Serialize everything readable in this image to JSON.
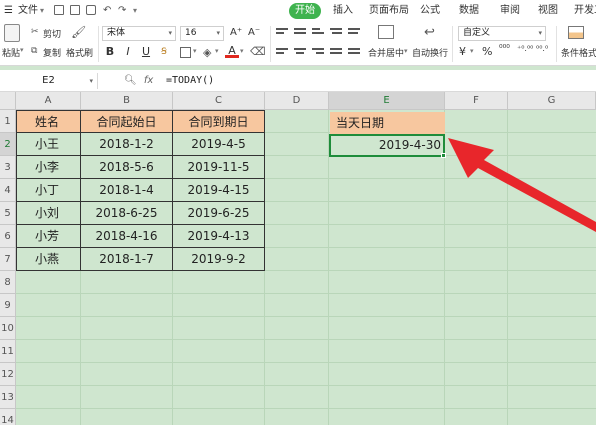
{
  "menubar": {
    "file_label": "文件",
    "tabs": [
      {
        "id": "home",
        "label": "开始"
      },
      {
        "id": "insert",
        "label": "插入"
      },
      {
        "id": "layout",
        "label": "页面布局"
      },
      {
        "id": "formula",
        "label": "公式"
      },
      {
        "id": "data",
        "label": "数据"
      },
      {
        "id": "review",
        "label": "审阅"
      },
      {
        "id": "view",
        "label": "视图"
      },
      {
        "id": "dev",
        "label": "开发工"
      }
    ]
  },
  "ribbon": {
    "paste_label": "粘贴",
    "cut_label": "剪切",
    "copy_label": "复制",
    "format_painter_label": "格式刷",
    "font_name": "宋体",
    "font_size": "16",
    "font_grow": "A⁺",
    "font_shrink": "A⁻",
    "bold": "B",
    "italic": "I",
    "underline": "U",
    "font_color_glyph": "A",
    "merge_center_label": "合并居中",
    "wrap_text_label": "自动换行",
    "number_format": "自定义",
    "currency_glyph": "¥",
    "percent_glyph": "%",
    "thousands_glyph": "⁰⁰⁰",
    "dec_inc": "⁺⁰.⁰⁰",
    "dec_dec": "⁰⁰.⁰",
    "conditional_format_label": "条件格式",
    "accent_color": "#3fb34f"
  },
  "formula_bar": {
    "name_box": "E2",
    "fx_label": "fx",
    "formula": "=TODAY()"
  },
  "sheet": {
    "columns": [
      "A",
      "B",
      "C",
      "D",
      "E",
      "F",
      "G"
    ],
    "rows": [
      "1",
      "2",
      "3",
      "4",
      "5",
      "6",
      "7",
      "8",
      "9",
      "10",
      "11",
      "12",
      "13",
      "14"
    ],
    "active_column": "E",
    "active_row": "2",
    "table": {
      "headers": [
        "姓名",
        "合同起始日",
        "合同到期日"
      ],
      "rows": [
        [
          "小王",
          "2018-1-2",
          "2019-4-5"
        ],
        [
          "小李",
          "2018-5-6",
          "2019-11-5"
        ],
        [
          "小丁",
          "2018-1-4",
          "2019-4-15"
        ],
        [
          "小刘",
          "2018-6-25",
          "2019-6-25"
        ],
        [
          "小芳",
          "2018-4-16",
          "2019-4-13"
        ],
        [
          "小燕",
          "2018-1-7",
          "2019-9-2"
        ]
      ]
    },
    "today_header": "当天日期",
    "today_value": "2019-4-30",
    "header_fill_color": "#f7c79f",
    "selection_color": "#1e8c3a",
    "background_color": "#cfe6cf"
  },
  "annotation": {
    "arrow_color": "#e8262b"
  }
}
